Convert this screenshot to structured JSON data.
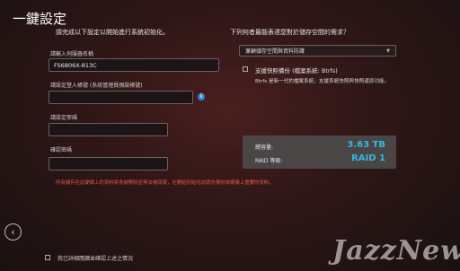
{
  "page": {
    "title": "一鍵設定",
    "left_header": "請完成以下設定以開始進行系統初始化。",
    "right_header": "下列何者最能表達您對於儲存空間的需求？"
  },
  "form": {
    "server_name_label": "請輸入伺服器名稱",
    "server_name_value": "FS6806X-813C",
    "admin_account_label": "請設定登入帳號 (系統管理員預設帳號)",
    "admin_account_value": "",
    "password_label": "請設定密碼",
    "password_value": "",
    "confirm_password_label": "確認密碼",
    "confirm_password_value": "",
    "info_icon": "i"
  },
  "storage": {
    "selected_option": "兼顧儲存空間與資料防護",
    "snapshot_label": "支援快照備份 (檔案系統: Btrfs)",
    "snapshot_desc": "Btrfs 是新一代的檔案系統，支援系統快照與快照還原功能。",
    "capacity_label": "總容量:",
    "capacity_value": "3.63 TB",
    "raid_label": "RAID 等級:",
    "raid_value": "RAID 1"
  },
  "warning": "所有儲存在此硬碟上的資料將會被刪除並無法被回復，在開始初始化前請先備份該硬碟上重要的資料。",
  "footer": {
    "confirm_label": "我已詳細閱讀並確認上述之情況",
    "back_symbol": "‹"
  },
  "watermark": "JazzNews",
  "colors": {
    "accent": "#36b6e0",
    "warning": "#e0574d",
    "info": "#2f86d6"
  }
}
